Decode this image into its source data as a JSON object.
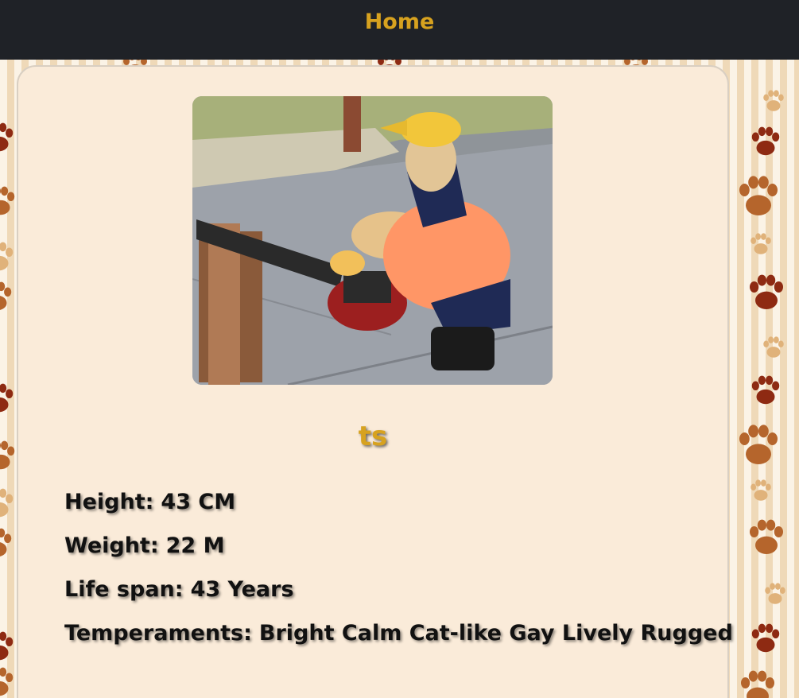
{
  "nav": {
    "home_label": "Home"
  },
  "background": {
    "pattern_icon": "paw-print-icon",
    "colors": [
      "#8e2a12",
      "#b5652c",
      "#e0b27a"
    ]
  },
  "card": {
    "image": {
      "icon": "dog-with-chainsaw-photo"
    },
    "breed_name": "ts",
    "stats": {
      "height_label": "Height:",
      "height_value": "43 CM",
      "weight_label": "Weight:",
      "weight_value": "22 M",
      "life_span_label": "Life span:",
      "life_span_value": "43 Years",
      "temperaments_label": "Temperaments:",
      "temperaments_value": "Bright Calm Cat-like Gay Lively Rugged"
    }
  },
  "colors": {
    "navbar_bg": "#1f2227",
    "accent": "#d7a21f",
    "card_bg": "#faebd9",
    "text": "#111111"
  }
}
